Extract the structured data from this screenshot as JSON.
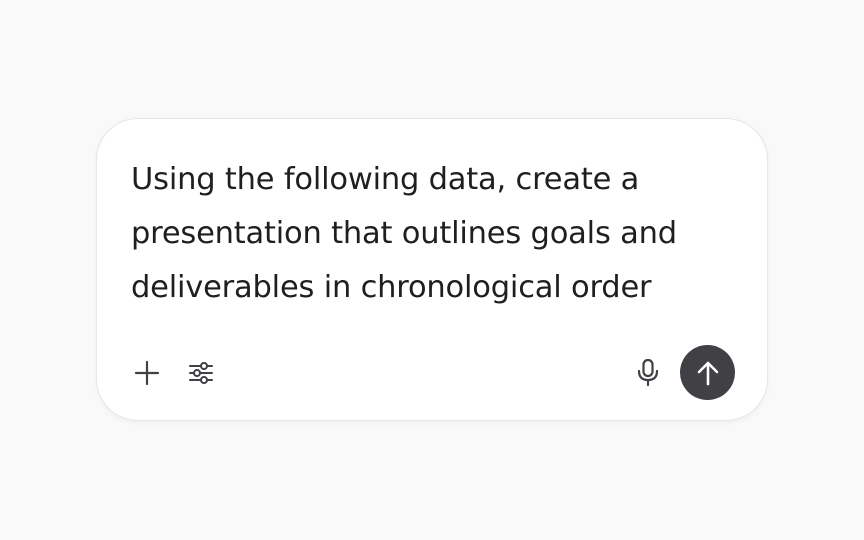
{
  "composer": {
    "prompt_text": "Using the following data, create a presentation that outlines goals and deliverables in chronological order"
  },
  "toolbar": {
    "add_icon": "plus-icon",
    "tools_icon": "sliders-icon",
    "mic_icon": "microphone-icon",
    "send_icon": "arrow-up-icon"
  },
  "colors": {
    "page_background": "#f9f9f9",
    "composer_background": "#ffffff",
    "text": "#1f1f1f",
    "icon": "#404045",
    "send_button": "#404045"
  }
}
